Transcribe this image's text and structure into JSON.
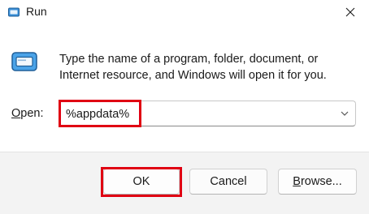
{
  "window": {
    "title": "Run",
    "icon": "run-app-icon",
    "close_icon": "close-icon"
  },
  "body": {
    "run_icon": "run-dialog-icon",
    "description": "Type the name of a program, folder, document, or Internet resource, and Windows will open it for you."
  },
  "open_field": {
    "label_accel": "O",
    "label_rest": "pen:",
    "value": "%appdata%",
    "chevron_icon": "chevron-down-icon"
  },
  "buttons": {
    "ok": "OK",
    "cancel": "Cancel",
    "browse_accel": "B",
    "browse_rest": "rowse..."
  },
  "colors": {
    "highlight": "#e00012",
    "accent": "#1f6fd1"
  }
}
